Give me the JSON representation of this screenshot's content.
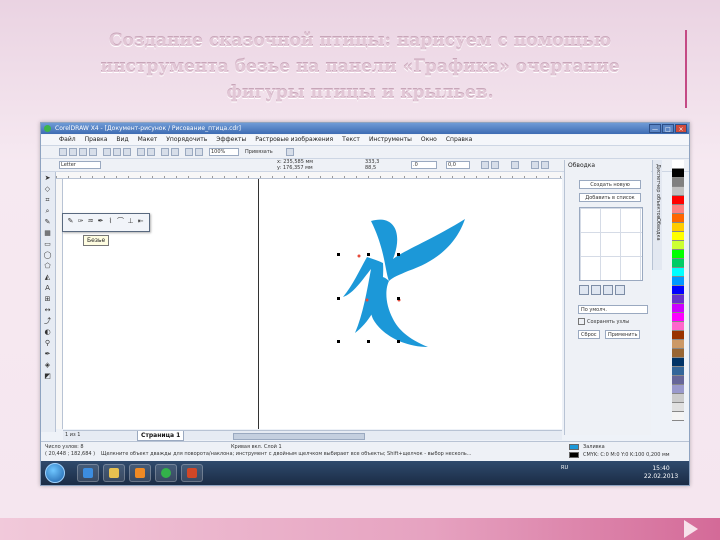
{
  "slide": {
    "title_line1": "Создание сказочной птицы: нарисуем с помощью",
    "title_line2": "инструмента безье на панели «Графика» очертание",
    "title_line3": "фигуры птицы и крыльев."
  },
  "app": {
    "window_title": "CorelDRAW X4 - [Документ-рисунок / Рисование_птица.cdr]",
    "window_buttons": [
      "—",
      "□",
      "×"
    ],
    "menu": [
      "Файл",
      "Правка",
      "Вид",
      "Макет",
      "Упорядочить",
      "Эффекты",
      "Растровые изображения",
      "Текст",
      "Инструменты",
      "Окно",
      "Справка"
    ],
    "toolbar1": {
      "zoom": "100%",
      "snap": "Привязать"
    },
    "toolbar2": {
      "paper": "Letter",
      "x": "x: 235,585 мм",
      "y": "y: 176,357 мм",
      "w": "333,3",
      "h": "88,5",
      "angle": ".0",
      "units": "0,0"
    },
    "flyout_tooltip": "Безье",
    "page_nav": "1 из 1",
    "page_tab": "Страница 1",
    "docker": {
      "title": "Обводка",
      "btn_new": "Создать новую",
      "btn_add": "Добавить в список",
      "select_label": "По умолч.",
      "check_label": "Сохранять узлы",
      "btn_reset": "Сброс",
      "btn_apply": "Применить"
    },
    "vertical_tabs": [
      "Диспетчер объектов",
      "Обводка"
    ],
    "palette_colors": [
      "#ffffff",
      "#000000",
      "#808080",
      "#c0c0c0",
      "#ff0000",
      "#ff8080",
      "#ff6600",
      "#ffcc00",
      "#ffff00",
      "#ccff33",
      "#00ff00",
      "#00cc66",
      "#00ffff",
      "#0099ff",
      "#0000ff",
      "#6633cc",
      "#cc00ff",
      "#ff00ff",
      "#ff66cc",
      "#993300",
      "#cc9966",
      "#996633",
      "#003366",
      "#336699",
      "#666699",
      "#9999cc",
      "#cccccc",
      "#e0e0e0",
      "#f4f4f4"
    ],
    "status": {
      "left1": "Число узлов: 8",
      "left2": "( 20,448 ; 182,684 )",
      "curve_info": "Кривая вкл. Слой 1",
      "hint": "Щелкните объект дважды для поворота/наклона; инструмент с двойным щелчком выбирает все объекты; Shift+щелчок - выбор несколь...",
      "fill_label": "Заливка",
      "stroke_label": "CMYK: C:0 M:0 Y:0 K:100 0,200 мм"
    },
    "taskbar": {
      "tray_text": "RU",
      "time": "15:40",
      "date": "22.02.2013"
    }
  },
  "colors": {
    "bird_fill": "#1c98d8",
    "title_color": "#e2c7d6",
    "accent": "#c44a85"
  }
}
